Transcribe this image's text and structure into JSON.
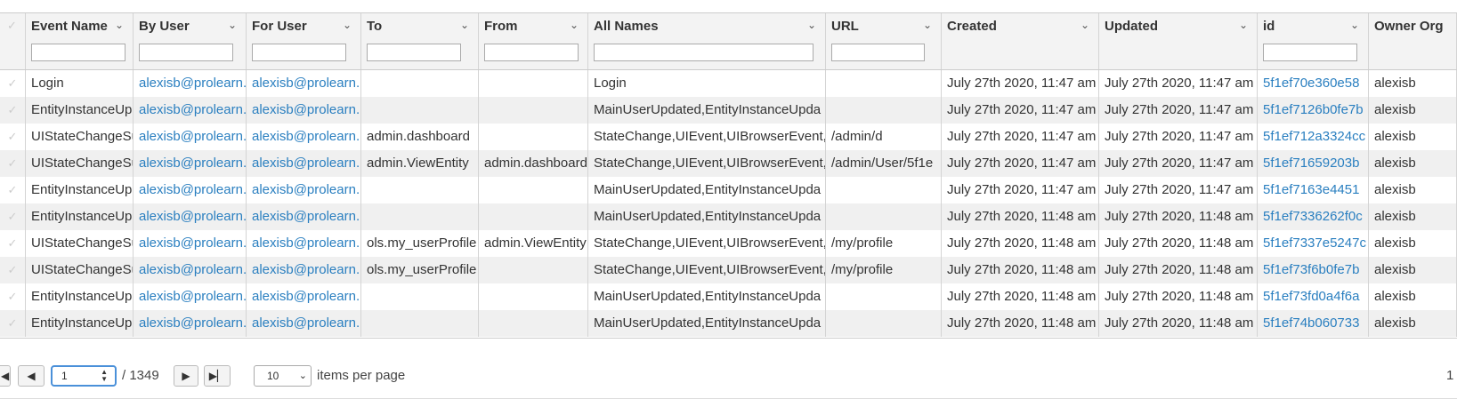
{
  "columns": [
    {
      "label": "Event Name",
      "filter": true
    },
    {
      "label": "By User",
      "filter": true
    },
    {
      "label": "For User",
      "filter": true
    },
    {
      "label": "To",
      "filter": true
    },
    {
      "label": "From",
      "filter": true
    },
    {
      "label": "All Names",
      "filter": true
    },
    {
      "label": "URL",
      "filter": true
    },
    {
      "label": "Created",
      "filter": false
    },
    {
      "label": "Updated",
      "filter": false
    },
    {
      "label": "id",
      "filter": true
    },
    {
      "label": "Owner Org",
      "filter": false
    }
  ],
  "rows": [
    [
      "Login",
      "alexisb@prolearn.",
      "alexisb@prolearn.",
      "",
      "",
      "Login",
      "",
      "July 27th 2020, 11:47 am",
      "July 27th 2020, 11:47 am",
      "5f1ef70e360e58",
      "alexisb"
    ],
    [
      "EntityInstanceUpc",
      "alexisb@prolearn.",
      "alexisb@prolearn.",
      "",
      "",
      "MainUserUpdated,EntityInstanceUpda",
      "",
      "July 27th 2020, 11:47 am",
      "July 27th 2020, 11:47 am",
      "5f1ef7126b0fe7b",
      "alexisb"
    ],
    [
      "UIStateChangeSu",
      "alexisb@prolearn.",
      "alexisb@prolearn.",
      "admin.dashboard",
      "",
      "StateChange,UIEvent,UIBrowserEvent,",
      "/admin/d",
      "July 27th 2020, 11:47 am",
      "July 27th 2020, 11:47 am",
      "5f1ef712a3324cc",
      "alexisb"
    ],
    [
      "UIStateChangeSu",
      "alexisb@prolearn.",
      "alexisb@prolearn.",
      "admin.ViewEntity",
      "admin.dashboard",
      "StateChange,UIEvent,UIBrowserEvent,",
      "/admin/User/5f1e",
      "July 27th 2020, 11:47 am",
      "July 27th 2020, 11:47 am",
      "5f1ef71659203b",
      "alexisb"
    ],
    [
      "EntityInstanceUpc",
      "alexisb@prolearn.",
      "alexisb@prolearn.",
      "",
      "",
      "MainUserUpdated,EntityInstanceUpda",
      "",
      "July 27th 2020, 11:47 am",
      "July 27th 2020, 11:47 am",
      "5f1ef7163e4451",
      "alexisb"
    ],
    [
      "EntityInstanceUpc",
      "alexisb@prolearn.",
      "alexisb@prolearn.",
      "",
      "",
      "MainUserUpdated,EntityInstanceUpda",
      "",
      "July 27th 2020, 11:48 am",
      "July 27th 2020, 11:48 am",
      "5f1ef7336262f0c",
      "alexisb"
    ],
    [
      "UIStateChangeSu",
      "alexisb@prolearn.",
      "alexisb@prolearn.",
      "ols.my_userProfile",
      "admin.ViewEntity",
      "StateChange,UIEvent,UIBrowserEvent,",
      "/my/profile",
      "July 27th 2020, 11:48 am",
      "July 27th 2020, 11:48 am",
      "5f1ef7337e5247c",
      "alexisb"
    ],
    [
      "UIStateChangeSu",
      "alexisb@prolearn.",
      "alexisb@prolearn.",
      "ols.my_userProfile",
      "",
      "StateChange,UIEvent,UIBrowserEvent,",
      "/my/profile",
      "July 27th 2020, 11:48 am",
      "July 27th 2020, 11:48 am",
      "5f1ef73f6b0fe7b",
      "alexisb"
    ],
    [
      "EntityInstanceUpc",
      "alexisb@prolearn.",
      "alexisb@prolearn.",
      "",
      "",
      "MainUserUpdated,EntityInstanceUpda",
      "",
      "July 27th 2020, 11:48 am",
      "July 27th 2020, 11:48 am",
      "5f1ef73fd0a4f6a",
      "alexisb"
    ],
    [
      "EntityInstanceUpc",
      "alexisb@prolearn.",
      "alexisb@prolearn.",
      "",
      "",
      "MainUserUpdated,EntityInstanceUpda",
      "",
      "July 27th 2020, 11:48 am",
      "July 27th 2020, 11:48 am",
      "5f1ef74b060733",
      "alexisb"
    ]
  ],
  "link_columns": [
    1,
    2,
    9
  ],
  "pager": {
    "first": "⏮",
    "prev": "◀",
    "page_value": "1",
    "total": "/ 1349",
    "next": "▶",
    "last": "⏭",
    "per_page": "10",
    "per_page_label": "items per page",
    "range_text": "1"
  }
}
